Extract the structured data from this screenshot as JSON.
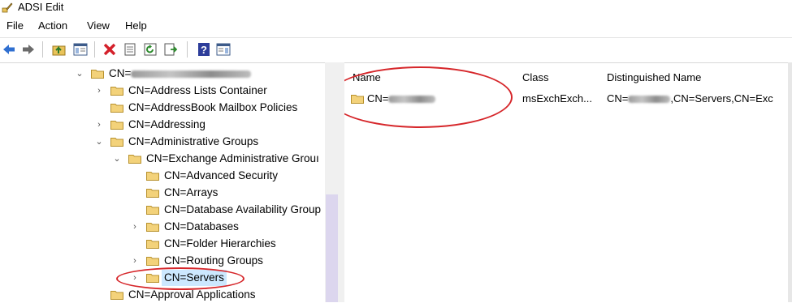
{
  "window": {
    "title": "ADSI Edit"
  },
  "menu": [
    "File",
    "Action",
    "View",
    "Help"
  ],
  "toolbar_icons": [
    "back-arrow-icon",
    "forward-arrow-icon",
    "up-folder-icon",
    "show-hide-tree-icon",
    "delete-icon",
    "properties-icon",
    "refresh-icon",
    "export-list-icon",
    "help-icon",
    "show-hide-action-pane-icon"
  ],
  "tree": {
    "root_prefix": "CN=",
    "items": [
      {
        "label": "CN=Address Lists Container"
      },
      {
        "label": "CN=AddressBook Mailbox Policies"
      },
      {
        "label": "CN=Addressing"
      },
      {
        "label": "CN=Administrative Groups"
      },
      {
        "label": "CN=Exchange Administrative Grouı"
      },
      {
        "label": "CN=Advanced Security"
      },
      {
        "label": "CN=Arrays"
      },
      {
        "label": "CN=Database Availability Group"
      },
      {
        "label": "CN=Databases"
      },
      {
        "label": "CN=Folder Hierarchies"
      },
      {
        "label": "CN=Routing Groups"
      },
      {
        "label": "CN=Servers"
      },
      {
        "label": "CN=Approval Applications"
      }
    ]
  },
  "list": {
    "columns": [
      "Name",
      "Class",
      "Distinguished Name"
    ],
    "rows": [
      {
        "name_prefix": "CN=",
        "class": "msExchExch...",
        "dn_prefix": "CN=",
        "dn_suffix": ",CN=Servers,CN=Exc"
      }
    ]
  },
  "colors": {
    "selection": "#cce8ff",
    "annotation": "#d6262a",
    "folder": "#f3d27a"
  }
}
